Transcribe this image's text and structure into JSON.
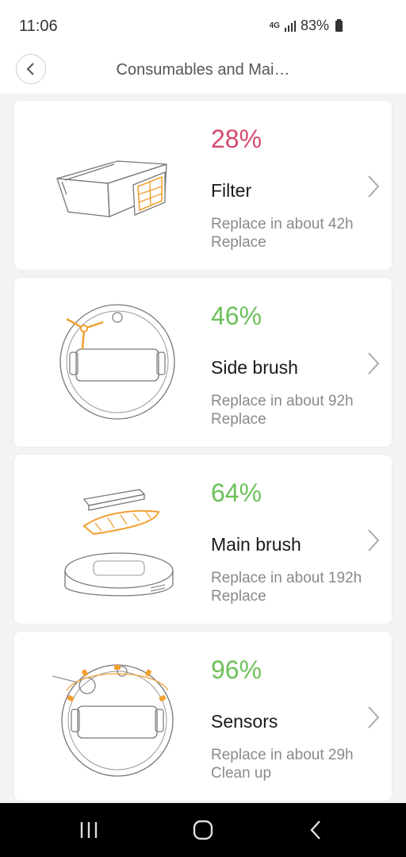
{
  "status": {
    "time": "11:06",
    "network": "4G",
    "battery": "83%"
  },
  "header": {
    "title": "Consumables and Mai…"
  },
  "colors": {
    "low": "#d44a6e",
    "ok": "#6cc15a",
    "accent": "#f0a030"
  },
  "items": [
    {
      "percent": "28%",
      "name": "Filter",
      "remaining": "Replace in about 42h",
      "action": "Replace",
      "level": "low",
      "icon": "filter-icon"
    },
    {
      "percent": "46%",
      "name": "Side brush",
      "remaining": "Replace in about 92h",
      "action": "Replace",
      "level": "ok",
      "icon": "side-brush-icon"
    },
    {
      "percent": "64%",
      "name": "Main brush",
      "remaining": "Replace in about 192h",
      "action": "Replace",
      "level": "ok",
      "icon": "main-brush-icon"
    },
    {
      "percent": "96%",
      "name": "Sensors",
      "remaining": "Replace in about 29h",
      "action": "Clean up",
      "level": "ok",
      "icon": "sensors-icon"
    }
  ]
}
